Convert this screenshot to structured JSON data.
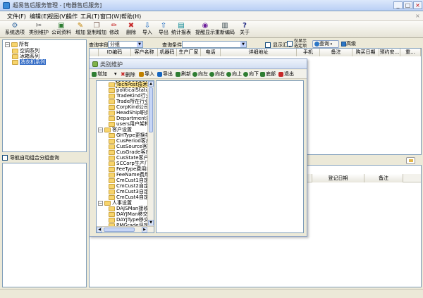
{
  "window": {
    "title": "超易售后服务管理 - [电器售后服务]",
    "min": "_",
    "max": "□",
    "close": "×",
    "inner_close": "×"
  },
  "menu": [
    "文件(F)",
    "编辑(E)",
    "视图(V)",
    "操作",
    "工具(T)",
    "窗口(W)",
    "帮助(H)"
  ],
  "toolbar": [
    {
      "label": "系统选项",
      "icon": "gear-icon",
      "glyph": "⚙",
      "color": "#3a6ea5"
    },
    {
      "label": "类别维护",
      "icon": "tools-icon",
      "glyph": "✂",
      "color": "#555555"
    },
    {
      "label": "公司资料",
      "icon": "company-icon",
      "glyph": "▣",
      "color": "#2e7d32"
    },
    {
      "label": "增加",
      "icon": "add-icon",
      "glyph": "✎",
      "color": "#c08000"
    },
    {
      "label": "复制增加",
      "icon": "copy-add-icon",
      "glyph": "❐",
      "color": "#6d4c41"
    },
    {
      "label": "修改",
      "icon": "edit-icon",
      "glyph": "✏",
      "color": "#c62828"
    },
    {
      "label": "删除",
      "icon": "delete-icon",
      "glyph": "✖",
      "color": "#c62828"
    },
    {
      "label": "导入",
      "icon": "import-icon",
      "glyph": "⇩",
      "color": "#1565c0"
    },
    {
      "label": "导出",
      "icon": "export-icon",
      "glyph": "⇧",
      "color": "#1565c0"
    },
    {
      "label": "统计报表",
      "icon": "report-icon",
      "glyph": "▤",
      "color": "#00838f"
    },
    {
      "label": "提醒显示",
      "icon": "reminder-icon",
      "glyph": "◉",
      "color": "#6a1b9a"
    },
    {
      "label": "重新编码",
      "icon": "recode-icon",
      "glyph": "▥",
      "color": "#37474f"
    },
    {
      "label": "关于",
      "icon": "help-icon",
      "glyph": "?",
      "color": "#1a237e"
    }
  ],
  "left_tree": [
    {
      "label": "所有",
      "level": 0,
      "expander": "−",
      "selected": false
    },
    {
      "label": "空调系列",
      "level": 1,
      "expander": "",
      "selected": false
    },
    {
      "label": "冰箱系列",
      "level": 1,
      "expander": "",
      "selected": false
    },
    {
      "label": "洗衣机系列",
      "level": 1,
      "expander": "",
      "selected": true
    }
  ],
  "nav_checkbox": {
    "label": "导航自动组合分组查询",
    "checked": false
  },
  "filter": {
    "field_label": "查询字段",
    "field_value": "分组",
    "cond_label": "查询条件",
    "cond_value": "",
    "summary_label": "显示汇总",
    "summary_checked": false,
    "only_selected_label_1": "仅显示",
    "only_selected_label_2": "选定项",
    "only_selected_checked": false,
    "query_btn": "查询",
    "advanced_btn": "高级"
  },
  "grid_columns": [
    "ID编码",
    "客户名称",
    "机器码",
    "生产厂家",
    "电话",
    "详细地址",
    "手机",
    "备注",
    "购买日期",
    "预约安...",
    "重..."
  ],
  "detail_columns": [
    "登记日期",
    "备注"
  ],
  "dialog": {
    "title": "类别维护",
    "toolbar": [
      {
        "label": "增加",
        "color": "#2e7d32",
        "has_dropdown": true,
        "dropdown": "▾"
      },
      {
        "label": "删除",
        "color": "#c62828",
        "glyph": "✖"
      },
      {
        "label": "导入",
        "color": "#c08000"
      },
      {
        "label": "导出",
        "color": "#1565c0"
      },
      {
        "label": "刷新",
        "color": "#2e7d32"
      },
      {
        "label": "向左",
        "color": "#2e7d32"
      },
      {
        "label": "向右",
        "color": "#2e7d32"
      },
      {
        "label": "向上",
        "color": "#2e7d32"
      },
      {
        "label": "向下",
        "color": "#2e7d32"
      },
      {
        "label": "底部",
        "color": "#2e7d32"
      },
      {
        "label": "退出",
        "color": "#c62828"
      }
    ],
    "tree": [
      {
        "label": "TechPost技术职位",
        "level": 1,
        "selected": true
      },
      {
        "label": "politicalStatus政治面貌",
        "level": 1
      },
      {
        "label": "TradeKind行业性质",
        "level": 1
      },
      {
        "label": "Trade所在行业",
        "level": 1
      },
      {
        "label": "CorpKind公司性质",
        "level": 1
      },
      {
        "label": "HeadShip职务类别",
        "level": 1
      },
      {
        "label": "Department部门",
        "level": 1
      },
      {
        "label": "users用户架构",
        "level": 1
      },
      {
        "label": "客户设置",
        "level": 0,
        "expander": "−"
      },
      {
        "label": "GHType更换类型",
        "level": 1
      },
      {
        "label": "CusPeriod客户阶段",
        "level": 1
      },
      {
        "label": "CusSource客户来源",
        "level": 1
      },
      {
        "label": "CusGrade客户等级",
        "level": 1
      },
      {
        "label": "CusState客户状态",
        "level": 1
      },
      {
        "label": "SCCorp生产厂家",
        "level": 1
      },
      {
        "label": "FeeType费用类别",
        "level": 1
      },
      {
        "label": "FeeName费用名称",
        "level": 1
      },
      {
        "label": "CmCust1自定义1",
        "level": 1
      },
      {
        "label": "CmCust2自定义2",
        "level": 1
      },
      {
        "label": "CmCust3自定义3",
        "level": 1
      },
      {
        "label": "CmCust4自定义4",
        "level": 1
      },
      {
        "label": "人事设置",
        "level": 0,
        "expander": "−"
      },
      {
        "label": "DAJSMan接收人",
        "level": 1
      },
      {
        "label": "DAYJMan移交人",
        "level": 1
      },
      {
        "label": "DAYJType移交状态",
        "level": 1
      },
      {
        "label": "PMGrade评定等级",
        "level": 1
      }
    ]
  }
}
